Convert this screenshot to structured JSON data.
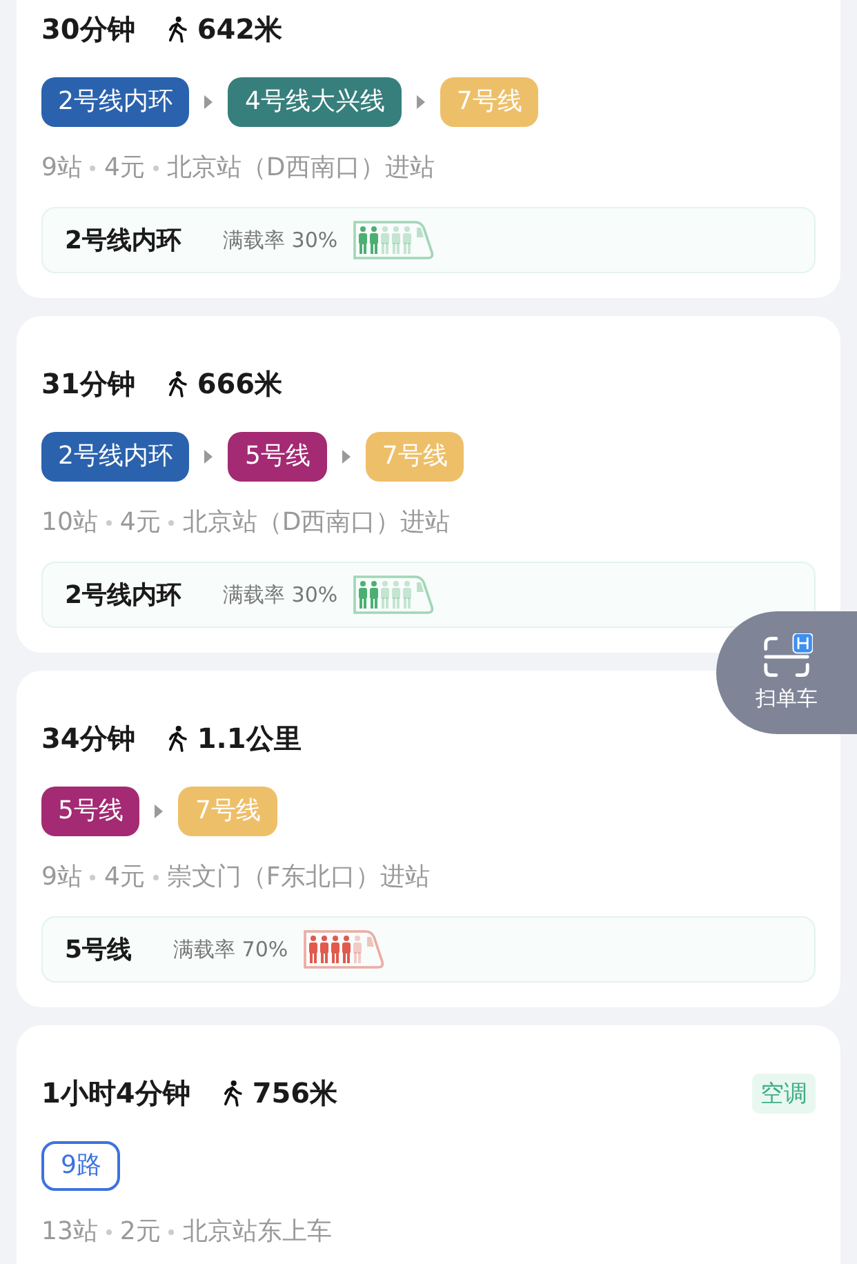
{
  "routes": [
    {
      "duration": "30分钟",
      "walk": "642米",
      "segments": [
        {
          "label": "2号线内环",
          "kind": "subway",
          "color": "#2b62ad"
        },
        {
          "label": "4号线大兴线",
          "kind": "subway",
          "color": "#367f7c"
        },
        {
          "label": "7号线",
          "kind": "subway",
          "color": "#eebf69"
        }
      ],
      "info": [
        "9站",
        "4元",
        "北京站（D西南口）进站"
      ],
      "crowd": {
        "line": "2号线内环",
        "text": "满载率 30%",
        "color": "#4caf72",
        "people": [
          {
            "filled": true
          },
          {
            "filled": true
          },
          {
            "filled": false
          },
          {
            "filled": false
          },
          {
            "filled": false
          }
        ]
      }
    },
    {
      "duration": "31分钟",
      "walk": "666米",
      "segments": [
        {
          "label": "2号线内环",
          "kind": "subway",
          "color": "#2b62ad"
        },
        {
          "label": "5号线",
          "kind": "subway",
          "color": "#a32a73"
        },
        {
          "label": "7号线",
          "kind": "subway",
          "color": "#eebf69"
        }
      ],
      "info": [
        "10站",
        "4元",
        "北京站（D西南口）进站"
      ],
      "crowd": {
        "line": "2号线内环",
        "text": "满载率 30%",
        "color": "#4caf72",
        "people": [
          {
            "filled": true
          },
          {
            "filled": true
          },
          {
            "filled": false
          },
          {
            "filled": false
          },
          {
            "filled": false
          }
        ]
      }
    },
    {
      "duration": "34分钟",
      "walk": "1.1公里",
      "segments": [
        {
          "label": "5号线",
          "kind": "subway",
          "color": "#a32a73"
        },
        {
          "label": "7号线",
          "kind": "subway",
          "color": "#eebf69"
        }
      ],
      "info": [
        "9站",
        "4元",
        "崇文门（F东北口）进站"
      ],
      "crowd": {
        "line": "5号线",
        "text": "满载率 70%",
        "color": "#e05a4e",
        "people": [
          {
            "filled": true
          },
          {
            "filled": true
          },
          {
            "filled": true
          },
          {
            "filled": true
          },
          {
            "filled": false
          }
        ]
      }
    },
    {
      "duration": "1小时4分钟",
      "walk": "756米",
      "tag": "空调",
      "segments": [
        {
          "label": "9路",
          "kind": "bus",
          "color": "#3d72de"
        }
      ],
      "info": [
        "13站",
        "2元",
        "北京站东上车"
      ]
    }
  ],
  "scan_button": {
    "label": "扫单车"
  }
}
